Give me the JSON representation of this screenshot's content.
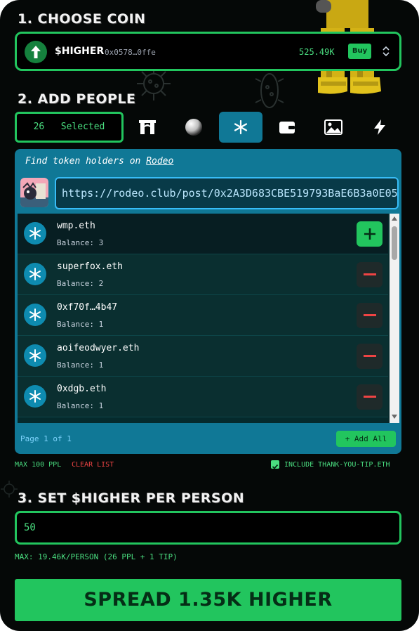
{
  "sections": {
    "choose_coin": "1. CHOOSE COIN",
    "add_people": "2. ADD PEOPLE",
    "set_amount": "3. SET $HIGHER PER PERSON"
  },
  "coin": {
    "name": "$HIGHER",
    "address": "0x0578…0ffe",
    "market_cap": "525.49K",
    "buy_label": "Buy",
    "icon": "arrow-up-icon"
  },
  "people": {
    "selected_count": "26",
    "selected_label": "Selected",
    "tabs": [
      {
        "icon": "gate-icon"
      },
      {
        "icon": "orb-icon"
      },
      {
        "icon": "asterisk-icon",
        "active": true
      },
      {
        "icon": "wallet-icon"
      },
      {
        "icon": "image-icon"
      },
      {
        "icon": "lightning-icon"
      }
    ]
  },
  "rodeo": {
    "find_prefix": "Find token holders on",
    "link_label": "Rodeo",
    "url": "https://rodeo.club/post/0x2A3D683CBE519793BaE6B3a0E05"
  },
  "holders": [
    {
      "name": "wmp.eth",
      "balance": "Balance: 3",
      "action": "add"
    },
    {
      "name": "superfox.eth",
      "balance": "Balance: 2",
      "action": "remove"
    },
    {
      "name": "0xf70f…4b47",
      "balance": "Balance: 1",
      "action": "remove"
    },
    {
      "name": "aoifeodwyer.eth",
      "balance": "Balance: 1",
      "action": "remove"
    },
    {
      "name": "0xdgb.eth",
      "balance": "Balance: 1",
      "action": "remove"
    }
  ],
  "pagination": {
    "label": "Page 1 of 1",
    "add_all_label": "+ Add All"
  },
  "options": {
    "max_people": "MAX 100 PPL",
    "clear_list": "CLEAR LIST",
    "include_tip": "INCLUDE THANK-YOU-TIP.ETH",
    "include_tip_checked": true
  },
  "amount": {
    "value": "50",
    "max_note": "MAX: 19.46K/PERSON (26 PPL + 1 TIP)"
  },
  "spread_button": "SPREAD 1.35K HIGHER",
  "colors": {
    "accent": "#22c55e",
    "panel": "#107896",
    "danger": "#ef4444",
    "background": "#050807"
  }
}
